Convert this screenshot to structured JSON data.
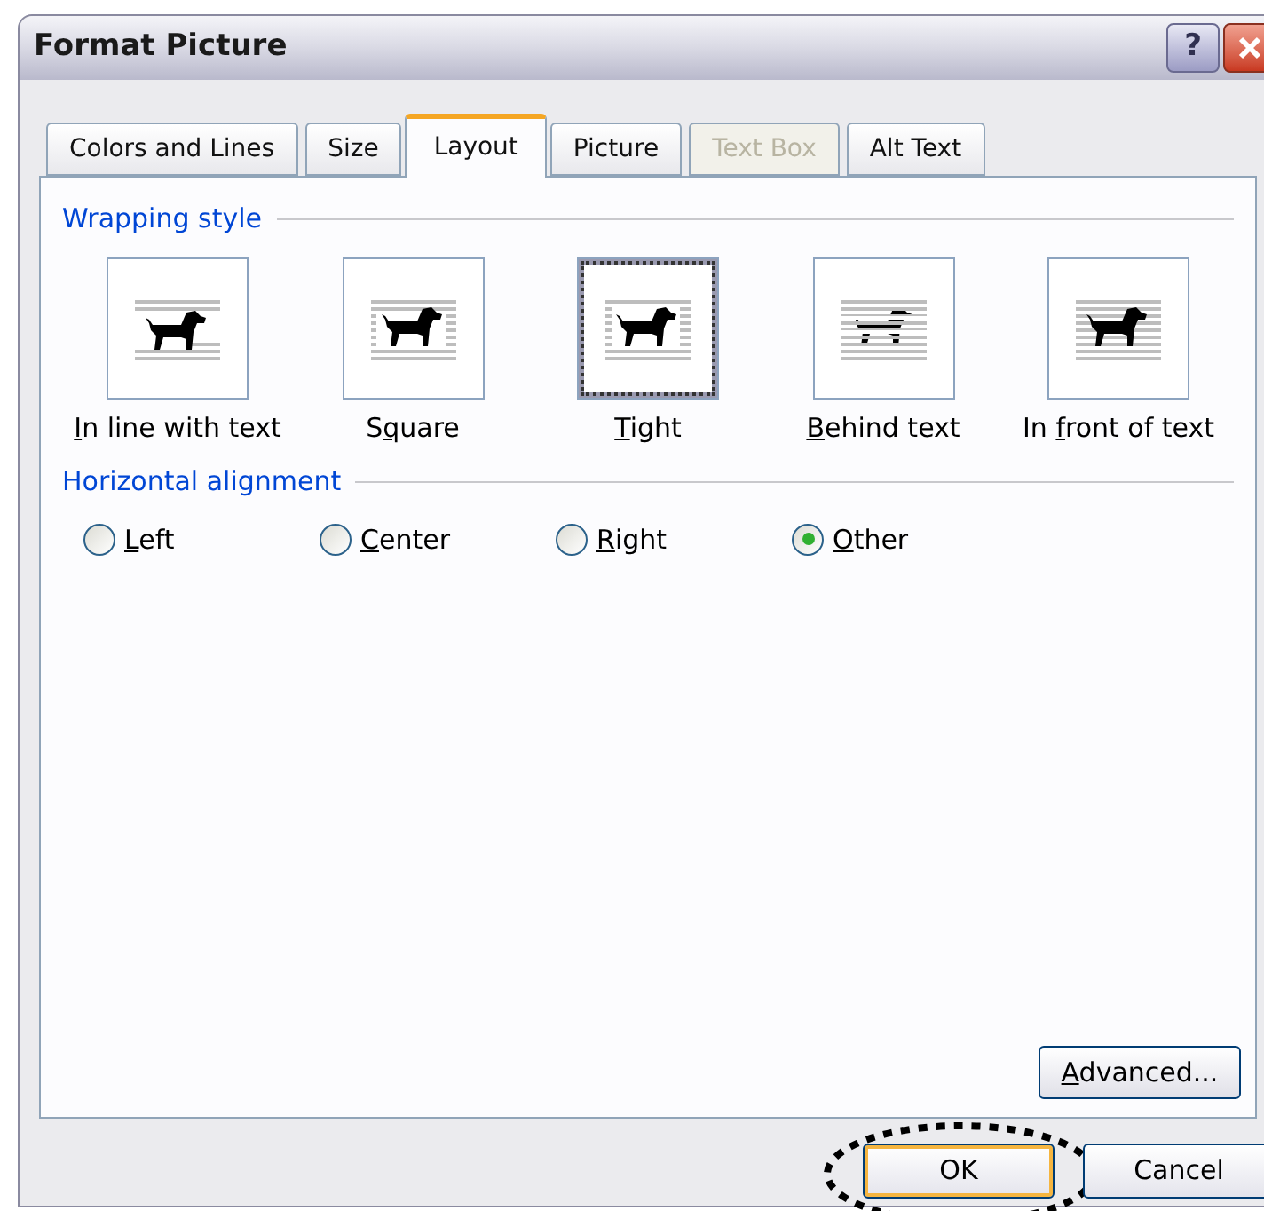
{
  "window": {
    "title": "Format Picture",
    "help": "?"
  },
  "tabs": [
    {
      "label": "Colors and Lines",
      "selected": false,
      "disabled": false
    },
    {
      "label": "Size",
      "selected": false,
      "disabled": false
    },
    {
      "label": "Layout",
      "selected": true,
      "disabled": false
    },
    {
      "label": "Picture",
      "selected": false,
      "disabled": false
    },
    {
      "label": "Text Box",
      "selected": false,
      "disabled": true
    },
    {
      "label": "Alt Text",
      "selected": false,
      "disabled": false
    }
  ],
  "wrapping_style": {
    "heading": "Wrapping style",
    "options": [
      {
        "kind": "inline",
        "key": "I",
        "post": "n line with text",
        "selected": false
      },
      {
        "kind": "square",
        "pre": "S",
        "key": "q",
        "post": "uare",
        "selected": false
      },
      {
        "kind": "tight",
        "key": "T",
        "post": "ight",
        "selected": true
      },
      {
        "kind": "behind",
        "key": "B",
        "post": "ehind text",
        "selected": false
      },
      {
        "kind": "front",
        "pre": "In ",
        "key": "f",
        "post": "ront of text",
        "selected": false
      }
    ]
  },
  "horizontal_alignment": {
    "heading": "Horizontal alignment",
    "options": [
      {
        "key": "L",
        "post": "eft",
        "selected": false
      },
      {
        "key": "C",
        "post": "enter",
        "selected": false
      },
      {
        "key": "R",
        "post": "ight",
        "selected": false
      },
      {
        "key": "O",
        "post": "ther",
        "selected": true
      }
    ]
  },
  "advanced_button": {
    "key": "A",
    "post": "dvanced..."
  },
  "buttons": [
    {
      "label": "OK",
      "default": true,
      "circled": true
    },
    {
      "label": "Cancel",
      "default": false,
      "circled": false
    }
  ]
}
